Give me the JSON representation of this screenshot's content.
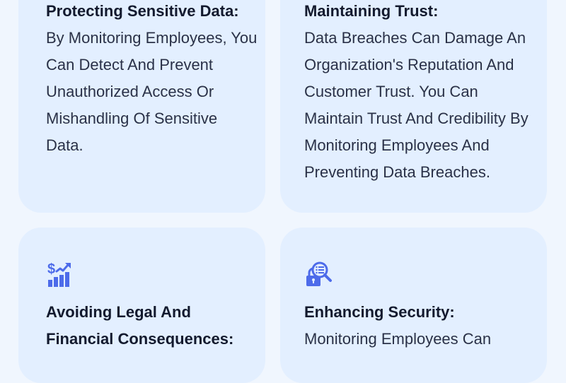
{
  "cards": [
    {
      "title": "Protecting Sensitive Data:",
      "text": "By Monitoring Employees, You Can Detect And Prevent Unauthorized Access Or Mishandling Of Sensitive Data."
    },
    {
      "title": "Maintaining Trust:",
      "text": "Data Breaches Can Damage An Organization's Reputation And Customer Trust. You Can Maintain Trust And Credibility By Monitoring Employees And Preventing Data Breaches."
    },
    {
      "icon": "financial-growth-icon",
      "title": "Avoiding Legal And Financial Consequences:"
    },
    {
      "icon": "security-search-lock-icon",
      "title": "Enhancing Security:",
      "text": "Monitoring Employees Can"
    }
  ],
  "colors": {
    "background": "#f0f6fe",
    "card": "#e3efff",
    "title": "#131a2e",
    "text": "#2a3147",
    "icon": "#4d6bea"
  }
}
